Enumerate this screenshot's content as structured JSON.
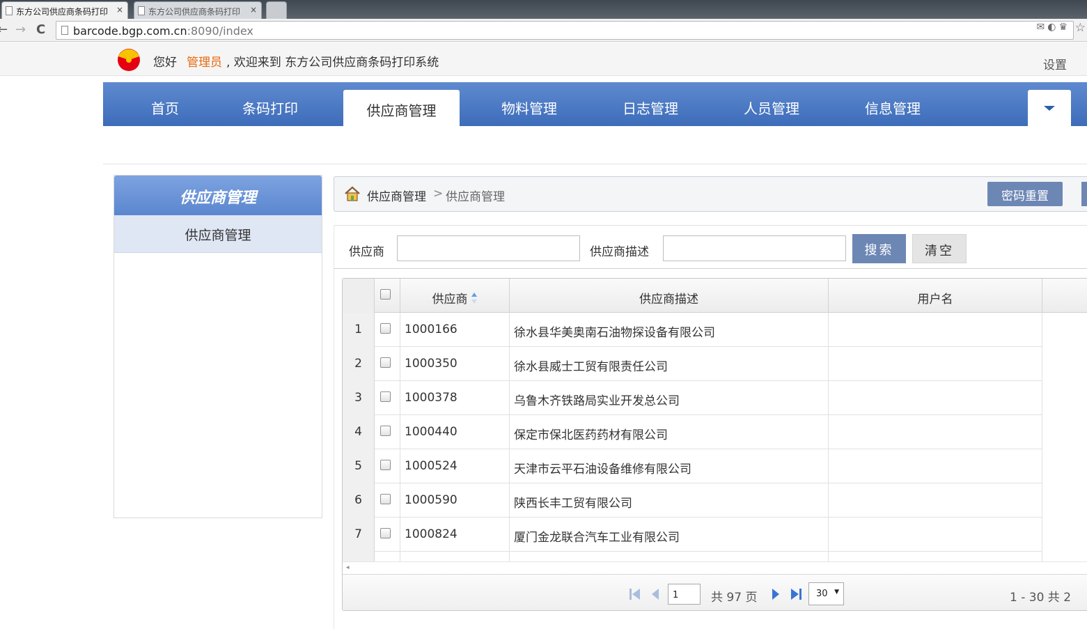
{
  "browser": {
    "tabs": [
      {
        "title": "东方公司供应商条码打印",
        "close": "×"
      },
      {
        "title": "东方公司供应商条码打印",
        "close": "×"
      }
    ],
    "url_host": "barcode.bgp.com.cn",
    "url_rest": ":8090/index",
    "back": "←",
    "forward": "→",
    "reload": "C"
  },
  "header": {
    "greeting": "您好",
    "username": "管理员",
    "welcome": ", 欢迎来到 东方公司供应商条码打印系统",
    "settings": "设置"
  },
  "nav": {
    "items": [
      "首页",
      "条码打印",
      "供应商管理",
      "物料管理",
      "日志管理",
      "人员管理",
      "信息管理"
    ],
    "active_index": 2
  },
  "sidebar": {
    "title": "供应商管理",
    "items": [
      "供应商管理"
    ]
  },
  "breadcrumb": {
    "root": "供应商管理",
    "separator": ">",
    "current": "供应商管理",
    "reset_password_label": "密码重置"
  },
  "search": {
    "supplier_label": "供应商",
    "supplier_value": "",
    "desc_label": "供应商描述",
    "desc_value": "",
    "search_label": "搜索",
    "clear_label": "清空"
  },
  "grid": {
    "columns": [
      "供应商",
      "供应商描述",
      "用户名"
    ],
    "sort_column": "供应商",
    "rows": [
      {
        "num": "1",
        "code": "1000166",
        "desc": "徐水县华美奥南石油物探设备有限公司",
        "user": ""
      },
      {
        "num": "2",
        "code": "1000350",
        "desc": "徐水县威士工贸有限责任公司",
        "user": ""
      },
      {
        "num": "3",
        "code": "1000378",
        "desc": "乌鲁木齐铁路局实业开发总公司",
        "user": ""
      },
      {
        "num": "4",
        "code": "1000440",
        "desc": "保定市保北医药药材有限公司",
        "user": ""
      },
      {
        "num": "5",
        "code": "1000524",
        "desc": "天津市云平石油设备维修有限公司",
        "user": ""
      },
      {
        "num": "6",
        "code": "1000590",
        "desc": "陕西长丰工贸有限公司",
        "user": ""
      },
      {
        "num": "7",
        "code": "1000824",
        "desc": "厦门金龙联合汽车工业有限公司",
        "user": ""
      }
    ]
  },
  "pager": {
    "current_page": "1",
    "total_pages_text": "共 97 页",
    "page_size": "30",
    "range_text": "1 - 30   共 2"
  },
  "colors": {
    "nav_blue": "#3d6cb9",
    "button_blue": "#6d87b4",
    "admin_orange": "#e86a10"
  }
}
